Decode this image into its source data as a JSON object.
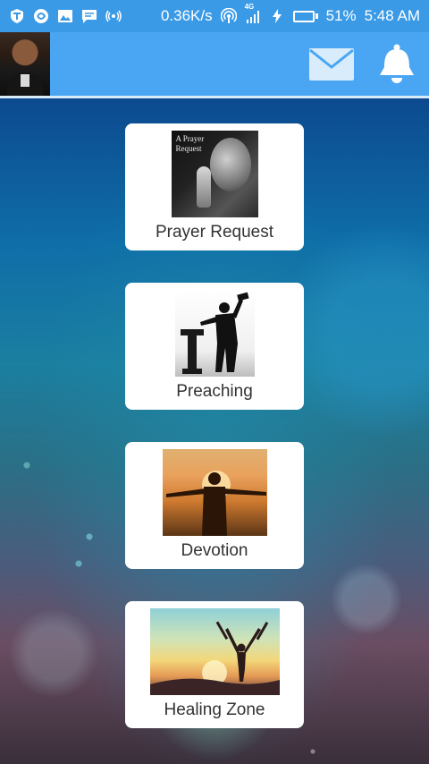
{
  "status_bar": {
    "network_speed": "0.36K/s",
    "network_type": "4G",
    "battery_percent": "51%",
    "battery_level": 0.51,
    "time": "5:48 AM",
    "left_icons": [
      "app-t-icon",
      "app-swirl-icon",
      "image-icon",
      "chat-icon",
      "radio-waves-icon"
    ],
    "right_icons": [
      "hotspot-icon",
      "signal-4g-icon",
      "charging-icon",
      "battery-icon"
    ]
  },
  "app_bar": {
    "avatar": "profile-photo",
    "actions": [
      "mail-icon",
      "bell-icon"
    ]
  },
  "colors": {
    "status_bar": "#3a9ae6",
    "app_bar": "#4aa6f2",
    "card": "#ffffff",
    "label": "#333333"
  },
  "menu": {
    "items": [
      {
        "label": "Prayer Request",
        "image": "prayer-image",
        "image_caption": "A Prayer Request"
      },
      {
        "label": "Preaching",
        "image": "preaching-image"
      },
      {
        "label": "Devotion",
        "image": "devotion-image"
      },
      {
        "label": "Healing Zone",
        "image": "healing-zone-image"
      }
    ]
  }
}
